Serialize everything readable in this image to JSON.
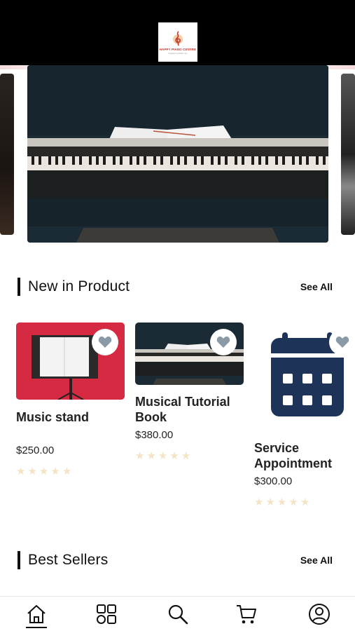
{
  "header": {
    "logo": {
      "brand": "HAPPY PIANO CENTRE",
      "tagline": "Supplying Music Joy"
    }
  },
  "carousel": {
    "slides": [
      "piano with open book",
      "left partial",
      "right partial"
    ]
  },
  "new_products": {
    "title": "New in Product",
    "see_all": "See All",
    "items": [
      {
        "name": "Music stand",
        "price": "$250.00",
        "rating": 0,
        "max_rating": 5
      },
      {
        "name": "Musical Tutorial Book",
        "name_line1": "Musical Tutorial",
        "name_line2": "Book",
        "price": "$380.00",
        "rating": 0,
        "max_rating": 5
      },
      {
        "name": "Service Appointment",
        "name_line1": "Service",
        "name_line2": "Appointment",
        "price": "$300.00",
        "rating": 0,
        "max_rating": 5
      }
    ]
  },
  "best_sellers": {
    "title": "Best Sellers",
    "see_all": "See All"
  },
  "bottom_nav": {
    "items": [
      {
        "icon": "home-icon",
        "active": true
      },
      {
        "icon": "categories-icon",
        "active": false
      },
      {
        "icon": "search-icon",
        "active": false
      },
      {
        "icon": "cart-icon",
        "active": false
      },
      {
        "icon": "profile-icon",
        "active": false
      }
    ]
  },
  "colors": {
    "header_bg": "#000000",
    "star_empty": "#f5e3c6",
    "fav_heart": "#8a9aa6",
    "calendar_navy": "#1e3358",
    "music_stand_bg": "#d62a42"
  }
}
